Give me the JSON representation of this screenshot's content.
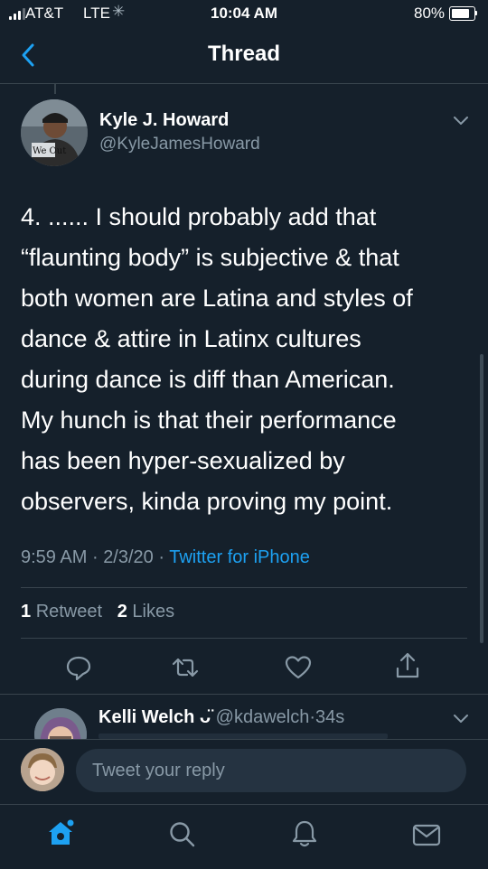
{
  "status_bar": {
    "carrier": "AT&T",
    "network": "LTE",
    "time": "10:04 AM",
    "battery_percent": "80%",
    "battery_level": 0.8
  },
  "header": {
    "title": "Thread",
    "back_icon": "chevron-left-icon"
  },
  "tweet": {
    "author_name": "Kyle J. Howard",
    "author_handle": "@KyleJamesHoward",
    "avatar_caption": "We Out",
    "body_lines": [
      "4. ...... I should probably add that",
      "“flaunting body” is subjective & that",
      "both women are Latina and styles of",
      "dance & attire in Latinx cultures",
      "during dance is diff than American.",
      "My hunch is that their performance",
      "has been hyper-sexualized by",
      "observers, kinda proving my point."
    ],
    "time": "9:59 AM",
    "date": "2/3/20",
    "separator": "·",
    "source": "Twitter for iPhone",
    "retweet_count": "1",
    "retweet_label": "Retweet",
    "like_count": "2",
    "like_label": "Likes",
    "actions": [
      "reply-icon",
      "retweet-icon",
      "like-icon",
      "share-icon"
    ]
  },
  "reply": {
    "author_name": "Kelli Welch",
    "name_symbol": "ᴗ̈",
    "author_handle": "@kdawelch",
    "separator": "·",
    "age": "34s"
  },
  "compose": {
    "placeholder": "Tweet your reply"
  },
  "bottom_nav": {
    "items": [
      "home-icon",
      "search-icon",
      "notifications-icon",
      "messages-icon"
    ],
    "accent": "#1da1f2"
  },
  "colors": {
    "background": "#15202b",
    "accent": "#1da1f2",
    "secondary_text": "#8899a6",
    "divider": "#38444d"
  }
}
